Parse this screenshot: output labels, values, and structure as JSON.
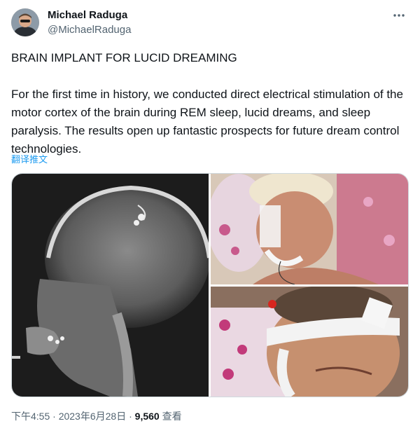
{
  "author": {
    "display_name": "Michael Raduga",
    "handle": "@MichaelRaduga"
  },
  "tweet": {
    "title": "BRAIN IMPLANT FOR LUCID DREAMING",
    "body": "For the first time in history, we conducted direct electrical stimulation of the motor cortex of the brain during REM sleep, lucid dreams, and sleep paralysis. The results open up fantastic prospects for future dream control technologies.",
    "translate_label": "翻译推文"
  },
  "meta": {
    "time": "下午4:55",
    "date": "2023年6月28日",
    "separator": "·",
    "views_count": "9,560",
    "views_label": "查看"
  },
  "icons": {
    "more": "more-dots-icon"
  },
  "colors": {
    "accent": "#1d9bf0",
    "text_primary": "#0f1419",
    "text_secondary": "#536471"
  }
}
